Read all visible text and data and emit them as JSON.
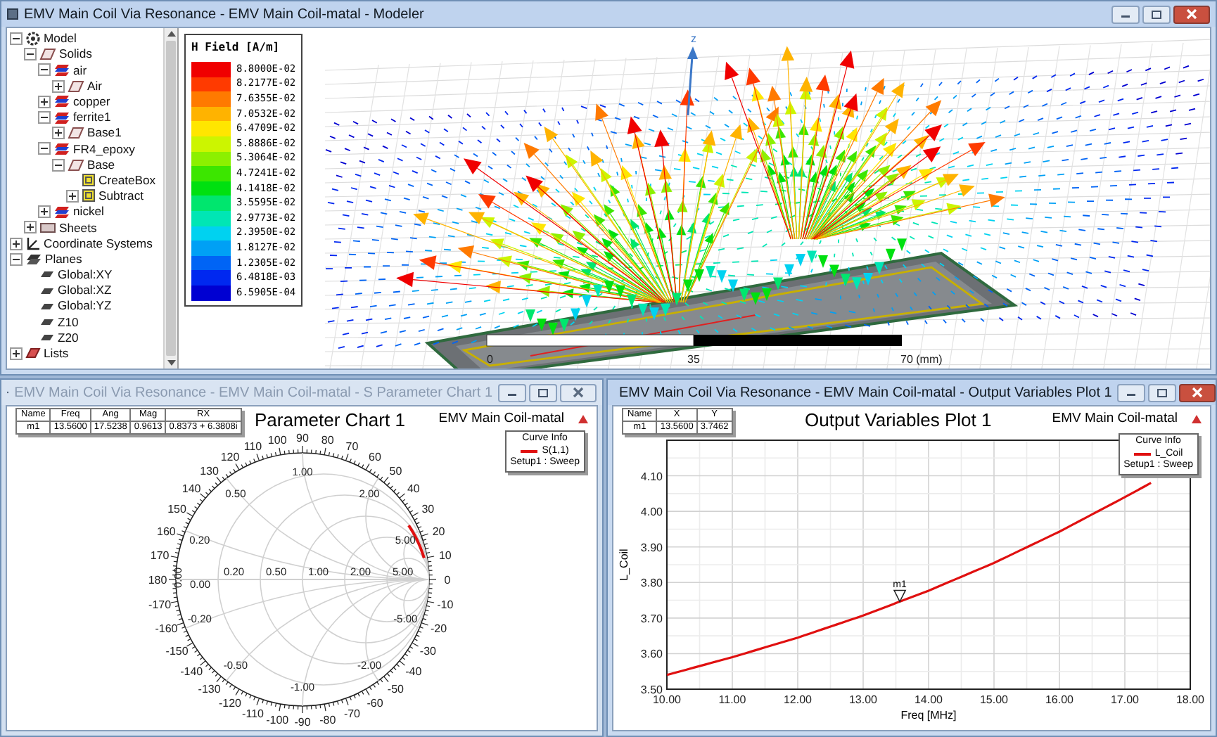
{
  "modeler": {
    "title": "EMV Main Coil Via Resonance - EMV Main Coil-matal - Modeler",
    "active": true,
    "tree": [
      {
        "label": "Model",
        "kind": "model",
        "expanded": true,
        "children": [
          {
            "label": "Solids",
            "kind": "folder",
            "expanded": true,
            "children": [
              {
                "label": "air",
                "kind": "material",
                "expanded": true,
                "children": [
                  {
                    "label": "Air",
                    "kind": "solid",
                    "expanded": false
                  }
                ]
              },
              {
                "label": "copper",
                "kind": "material",
                "expanded": false
              },
              {
                "label": "ferrite1",
                "kind": "material",
                "expanded": true,
                "children": [
                  {
                    "label": "Base1",
                    "kind": "solid",
                    "expanded": false
                  }
                ]
              },
              {
                "label": "FR4_epoxy",
                "kind": "material",
                "expanded": true,
                "children": [
                  {
                    "label": "Base",
                    "kind": "solid",
                    "expanded": true,
                    "children": [
                      {
                        "label": "CreateBox",
                        "kind": "operation"
                      },
                      {
                        "label": "Subtract",
                        "kind": "operation",
                        "expanded": false
                      }
                    ]
                  }
                ]
              },
              {
                "label": "nickel",
                "kind": "material",
                "expanded": false
              }
            ]
          },
          {
            "label": "Sheets",
            "kind": "sheets",
            "expanded": false
          }
        ]
      },
      {
        "label": "Coordinate Systems",
        "kind": "coords",
        "expanded": false
      },
      {
        "label": "Planes",
        "kind": "planes",
        "expanded": true,
        "children": [
          {
            "label": "Global:XY",
            "kind": "plane"
          },
          {
            "label": "Global:XZ",
            "kind": "plane"
          },
          {
            "label": "Global:YZ",
            "kind": "plane"
          },
          {
            "label": "Z10",
            "kind": "plane"
          },
          {
            "label": "Z20",
            "kind": "plane"
          }
        ]
      },
      {
        "label": "Lists",
        "kind": "lists",
        "expanded": false
      }
    ],
    "legend": {
      "title": "H Field [A/m]",
      "entries": [
        {
          "value": "8.8000E-02",
          "color": "#f00000"
        },
        {
          "value": "8.2177E-02",
          "color": "#ff3a00"
        },
        {
          "value": "7.6355E-02",
          "color": "#ff7a00"
        },
        {
          "value": "7.0532E-02",
          "color": "#ffb300"
        },
        {
          "value": "6.4709E-02",
          "color": "#ffe600"
        },
        {
          "value": "5.8886E-02",
          "color": "#ccf500"
        },
        {
          "value": "5.3064E-02",
          "color": "#8cf000"
        },
        {
          "value": "4.7241E-02",
          "color": "#3ce600"
        },
        {
          "value": "4.1418E-02",
          "color": "#00e010"
        },
        {
          "value": "3.5595E-02",
          "color": "#00e66e"
        },
        {
          "value": "2.9773E-02",
          "color": "#00e6b4"
        },
        {
          "value": "2.3950E-02",
          "color": "#00d2f0"
        },
        {
          "value": "1.8127E-02",
          "color": "#00a0f5"
        },
        {
          "value": "1.2305E-02",
          "color": "#0064f5"
        },
        {
          "value": "6.4818E-03",
          "color": "#0028f0"
        },
        {
          "value": "6.5905E-04",
          "color": "#0000d2"
        }
      ]
    },
    "axis_label": "z",
    "scale_labels": [
      "0",
      "35",
      "70 (mm)"
    ]
  },
  "s_parameter_window": {
    "title": "EMV Main Coil Via Resonance - EMV Main Coil-matal - S Parameter Chart 1",
    "active": false,
    "chart_title": "Parameter Chart 1",
    "design": "EMV Main Coil-matal",
    "marker_table": {
      "columns": [
        "Name",
        "Freq",
        "Ang",
        "Mag",
        "RX"
      ],
      "rows": [
        [
          "m1",
          "13.5600",
          "17.5238",
          "0.9613",
          "0.8373 + 6.3808i"
        ]
      ]
    },
    "curve_info": {
      "title": "Curve Info",
      "curve": "S(1,1)",
      "setup": "Setup1 : Sweep",
      "color": "#e01010"
    },
    "smith": {
      "angle_labels": [
        "100",
        "90",
        "80",
        "110",
        "70",
        "120",
        "60",
        "130",
        "50",
        "140",
        "40",
        "150",
        "30",
        "160",
        "20",
        "170",
        "10",
        "180",
        "0",
        "-170",
        "-10",
        "-160",
        "-20",
        "-150",
        "-30",
        "-140",
        "-40",
        "-130",
        "-50",
        "-120",
        "-60",
        "-110",
        "-70",
        "-100",
        "-90",
        "-80"
      ],
      "resistance_labels": [
        "0.00",
        "0.00",
        "0.20",
        "0.50",
        "1.00",
        "2.00",
        "5.00"
      ],
      "reactance_labels_upper": [
        "0.20",
        "0.50",
        "1.00",
        "2.00",
        "5.00"
      ],
      "reactance_labels_lower": [
        "-0.20",
        "-0.50",
        "-1.00",
        "-2.00",
        "-5.00"
      ]
    }
  },
  "output_window": {
    "title": "EMV Main Coil Via Resonance - EMV Main Coil-matal - Output Variables Plot 1",
    "active": true,
    "design": "EMV Main Coil-matal",
    "marker_table": {
      "columns": [
        "Name",
        "X",
        "Y"
      ],
      "rows": [
        [
          "m1",
          "13.5600",
          "3.7462"
        ]
      ]
    },
    "curve_info": {
      "title": "Curve Info",
      "setup": "Setup1 : Sweep"
    },
    "chart_data": {
      "type": "line",
      "title": "Output Variables Plot 1",
      "xlabel": "Freq [MHz]",
      "ylabel": "L_Coil",
      "x": [
        10,
        11,
        12,
        13,
        14,
        15,
        16,
        17,
        17.4
      ],
      "series": [
        {
          "name": "L_Coil",
          "color": "#e01010",
          "values": [
            3.54,
            3.59,
            3.645,
            3.707,
            3.777,
            3.855,
            3.943,
            4.04,
            4.08
          ]
        }
      ],
      "grid": true,
      "xlim": [
        10,
        18
      ],
      "ylim": [
        3.5,
        4.2
      ],
      "xticks": [
        {
          "value": 10,
          "label": "10.00"
        },
        {
          "value": 11,
          "label": "11.00"
        },
        {
          "value": 12,
          "label": "12.00"
        },
        {
          "value": 13,
          "label": "13.00"
        },
        {
          "value": 14,
          "label": "14.00"
        },
        {
          "value": 15,
          "label": "15.00"
        },
        {
          "value": 16,
          "label": "16.00"
        },
        {
          "value": 17,
          "label": "17.00"
        },
        {
          "value": 18,
          "label": "18.00"
        }
      ],
      "yticks": [
        {
          "value": 3.5,
          "label": "3.50"
        },
        {
          "value": 3.6,
          "label": "3.60"
        },
        {
          "value": 3.7,
          "label": "3.70"
        },
        {
          "value": 3.8,
          "label": "3.80"
        },
        {
          "value": 3.9,
          "label": "3.90"
        },
        {
          "value": 4.0,
          "label": "4.00"
        },
        {
          "value": 4.1,
          "label": "4.10"
        }
      ],
      "annotations": [
        {
          "x": 13.56,
          "y": 3.7462,
          "text": "m1"
        }
      ]
    }
  }
}
